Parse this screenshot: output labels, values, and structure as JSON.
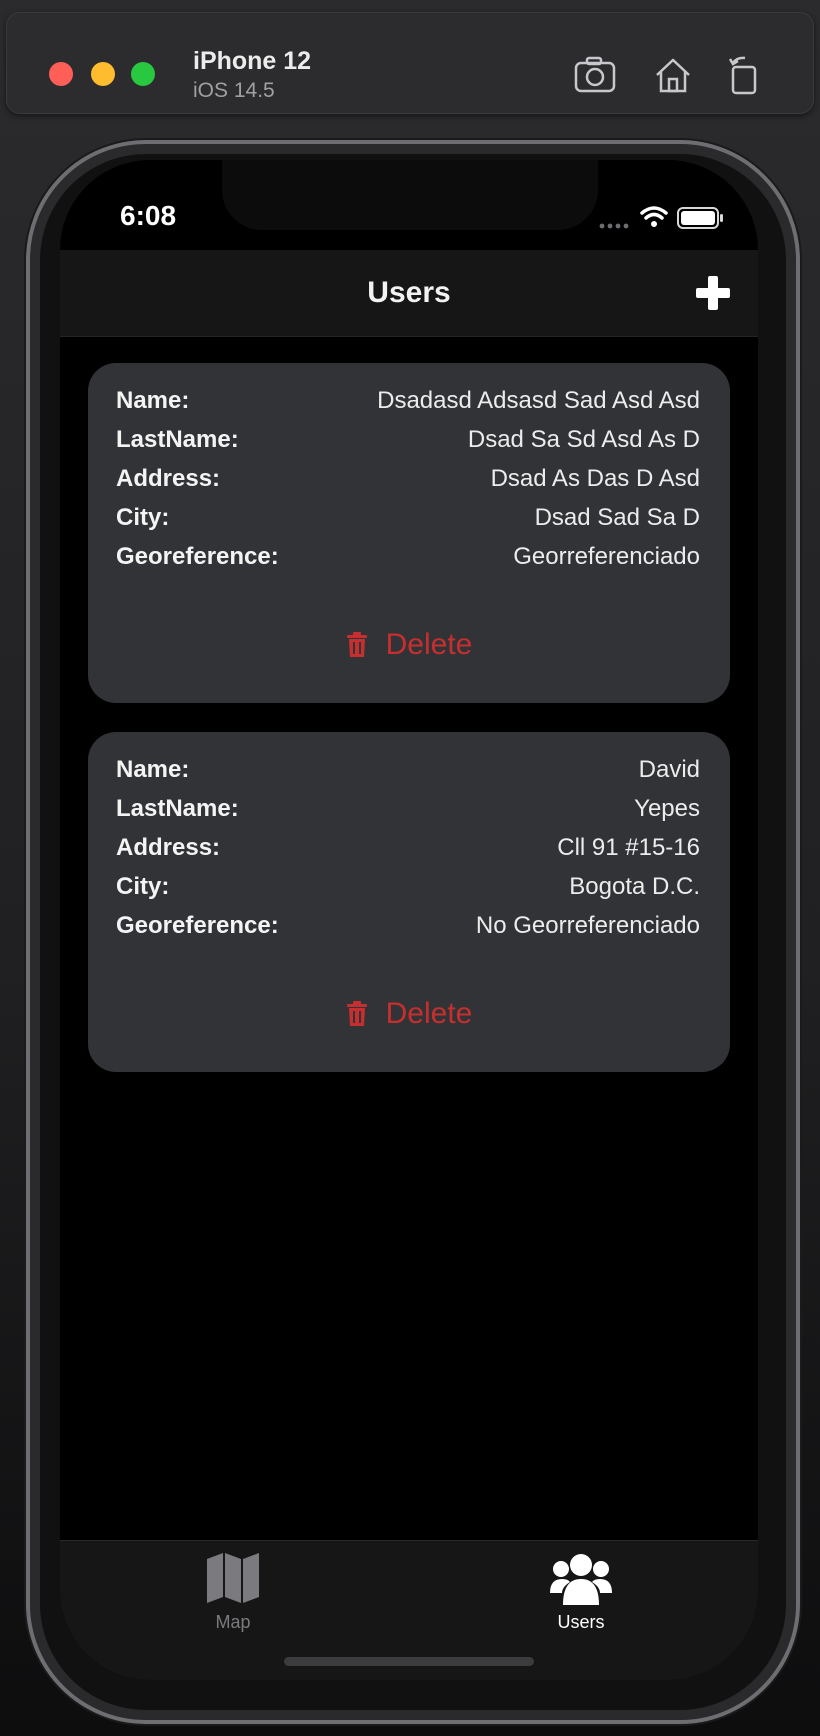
{
  "simulator": {
    "device": "iPhone 12",
    "os": "iOS 14.5"
  },
  "status_bar": {
    "time": "6:08"
  },
  "nav": {
    "title": "Users"
  },
  "users": [
    {
      "name_label": "Name:",
      "name": "Dsadasd Adsasd Sad Asd Asd",
      "lastname_label": "LastName:",
      "lastname": "Dsad Sa Sd Asd As D",
      "address_label": "Address:",
      "address": "Dsad As Das D Asd",
      "city_label": "City:",
      "city": "Dsad Sad Sa D",
      "geo_label": "Georeference:",
      "geo": "Georreferenciado",
      "delete_label": "Delete"
    },
    {
      "name_label": "Name:",
      "name": "David",
      "lastname_label": "LastName:",
      "lastname": "Yepes",
      "address_label": "Address:",
      "address": "Cll 91 #15-16",
      "city_label": "City:",
      "city": "Bogota D.C.",
      "geo_label": "Georeference:",
      "geo": "No Georreferenciado",
      "delete_label": "Delete"
    }
  ],
  "tabs": [
    {
      "label": "Map",
      "icon": "map-icon",
      "active": false
    },
    {
      "label": "Users",
      "icon": "users-icon",
      "active": true
    }
  ],
  "colors": {
    "delete": "#c62f2f",
    "card": "#323336",
    "background": "#000000"
  }
}
